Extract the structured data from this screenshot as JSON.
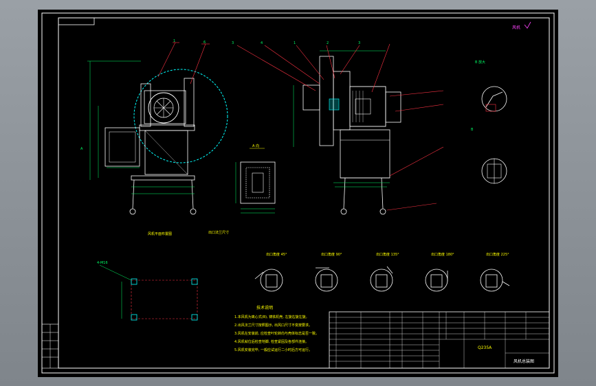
{
  "drawing": {
    "corner_tag": "风机",
    "part_labels": [
      "1",
      "6",
      "3",
      "4",
      "1",
      "2",
      "3"
    ],
    "detail_title_A": "A 向",
    "detail_title_B": "B 放大",
    "front_view_caption": "风机平面布置图",
    "outlet_caption": "出口法兰尺寸",
    "outlet_angles": [
      "出口角度 45°",
      "出口角度 90°",
      "出口角度 135°",
      "出口角度 180°",
      "出口角度 225°"
    ],
    "notes_title": "技术说明",
    "notes": [
      "1.本风机为离心式(B), 铸铁机壳, 左旋右旋左旋。",
      "2.出风法兰尺寸按照图示, 出风口尺寸不变按要求。",
      "3.风机在安装前, 应检查叶轮转向与壳体标志是否一致。",
      "4.风机就位后检查地脚, 检查紧固及各部件连接。",
      "5.风机安装完毕, 一般应试运行二小时后方可运行。"
    ],
    "material": "Q235A",
    "drawing_name": "风机总装图"
  },
  "colors": {
    "frame": "#ffffff",
    "outline": "#ffffff",
    "dimension": "#00ff66",
    "leader": "#ff3344",
    "text_yellow": "#ffff00",
    "cyan": "#00ffff",
    "magenta": "#ff44ff"
  }
}
